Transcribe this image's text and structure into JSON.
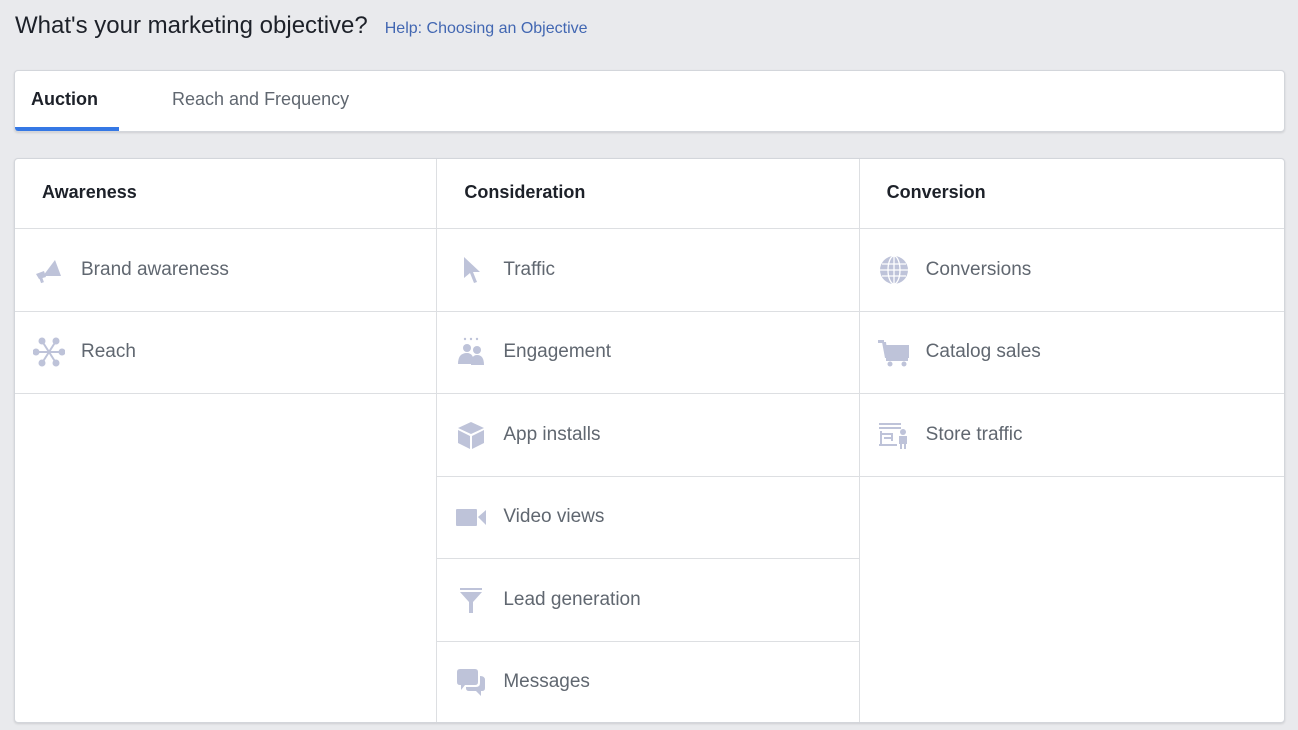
{
  "header": {
    "title": "What's your marketing objective?",
    "help_link": "Help: Choosing an Objective"
  },
  "tabs": [
    {
      "label": "Auction",
      "active": true
    },
    {
      "label": "Reach and Frequency",
      "active": false
    }
  ],
  "colors": {
    "accent": "#3578e5",
    "link": "#4267b2",
    "icon": "#bec3d9",
    "text_muted": "#606770"
  },
  "columns": [
    {
      "title": "Awareness",
      "objectives": [
        {
          "label": "Brand awareness",
          "icon": "megaphone-icon"
        },
        {
          "label": "Reach",
          "icon": "network-icon"
        }
      ]
    },
    {
      "title": "Consideration",
      "objectives": [
        {
          "label": "Traffic",
          "icon": "cursor-icon"
        },
        {
          "label": "Engagement",
          "icon": "people-icon"
        },
        {
          "label": "App installs",
          "icon": "box-icon"
        },
        {
          "label": "Video views",
          "icon": "video-camera-icon"
        },
        {
          "label": "Lead generation",
          "icon": "funnel-icon"
        },
        {
          "label": "Messages",
          "icon": "chat-bubbles-icon"
        }
      ]
    },
    {
      "title": "Conversion",
      "objectives": [
        {
          "label": "Conversions",
          "icon": "globe-icon"
        },
        {
          "label": "Catalog sales",
          "icon": "cart-icon"
        },
        {
          "label": "Store traffic",
          "icon": "store-icon"
        }
      ]
    }
  ]
}
